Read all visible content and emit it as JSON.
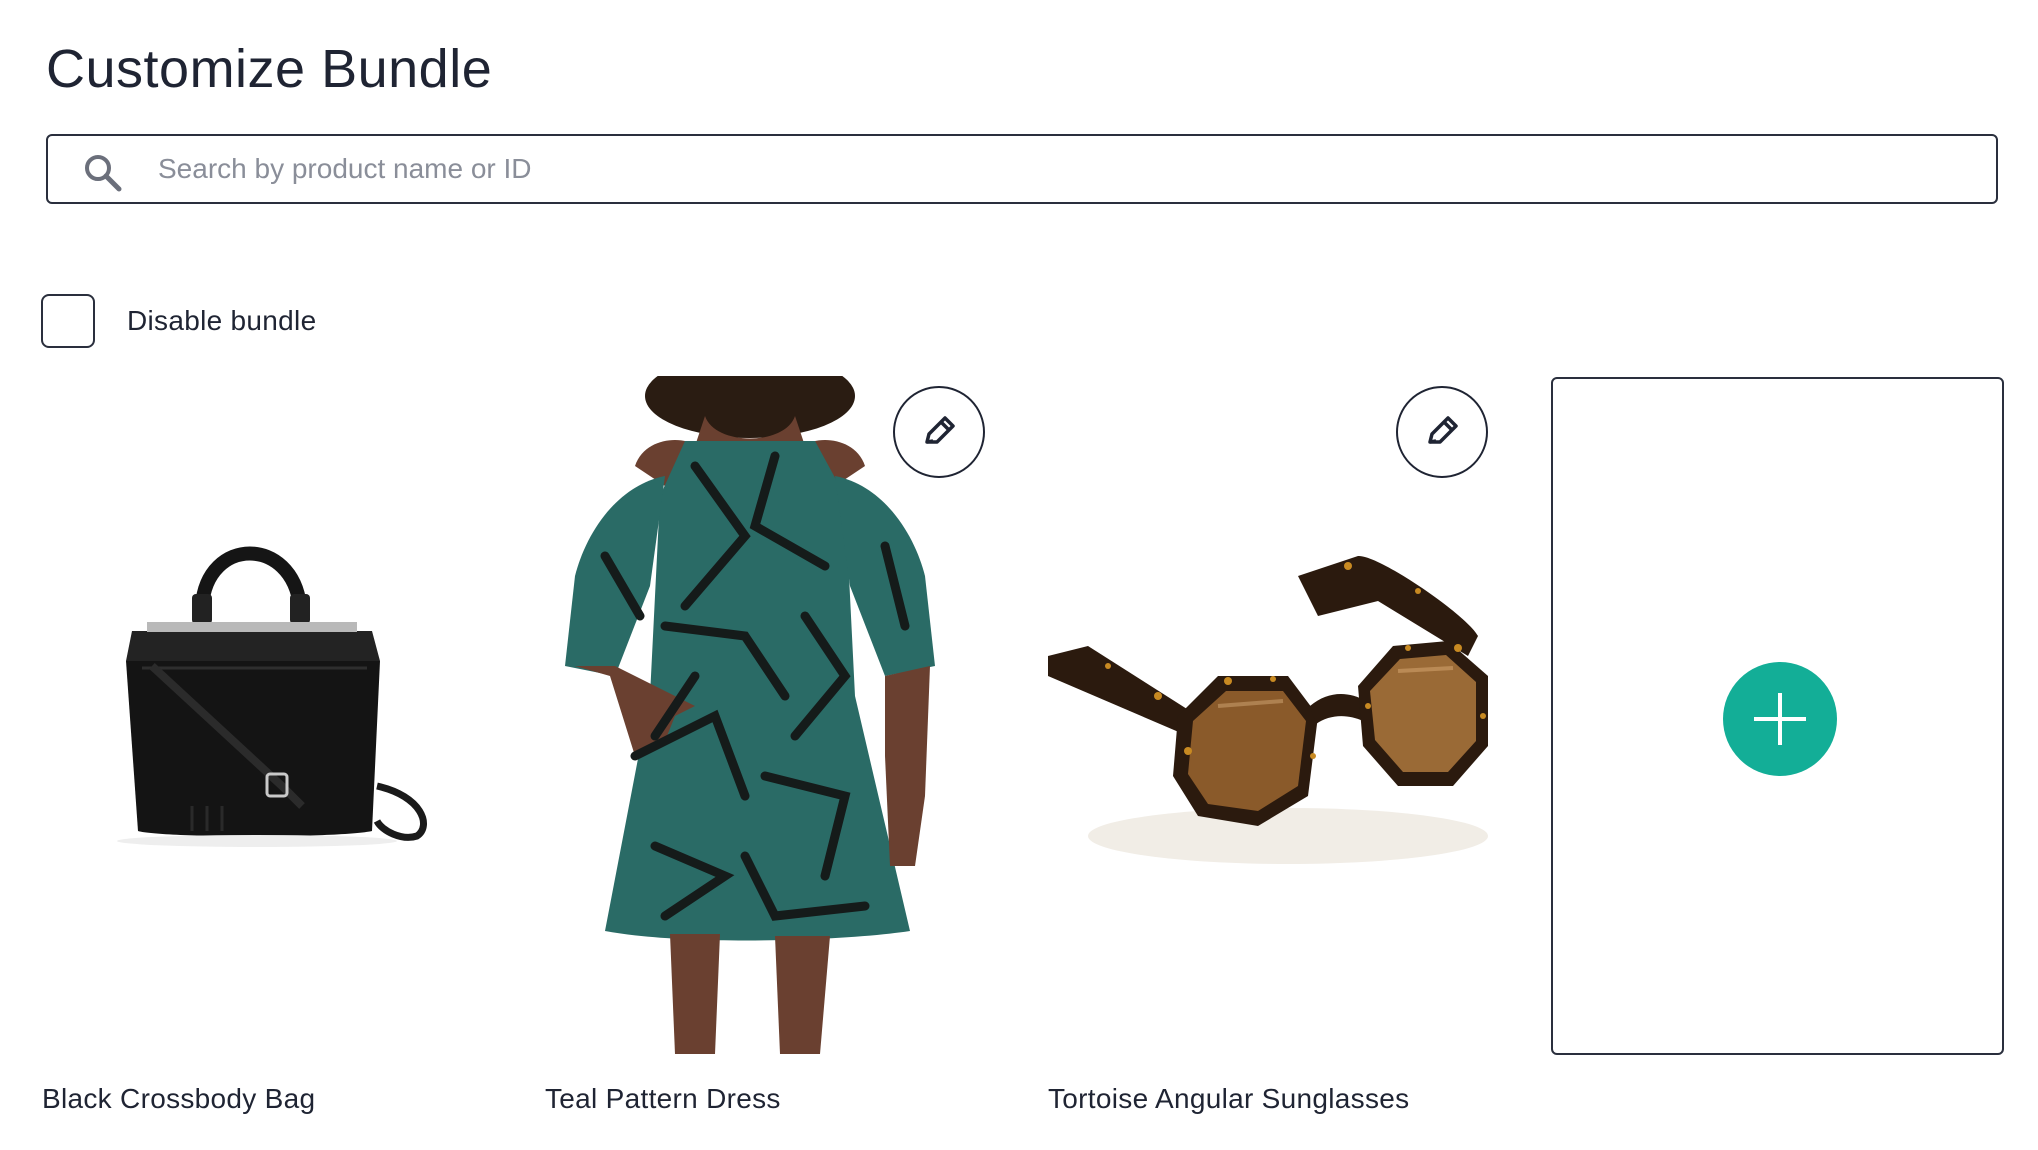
{
  "page": {
    "title": "Customize Bundle"
  },
  "search": {
    "placeholder": "Search by product name or ID",
    "value": ""
  },
  "disable_bundle": {
    "label": "Disable bundle",
    "checked": false
  },
  "products": [
    {
      "name": "Black Crossbody Bag",
      "image": "black-crossbody-bag-image",
      "editable": false
    },
    {
      "name": "Teal Pattern Dress",
      "image": "teal-pattern-dress-image",
      "editable": true
    },
    {
      "name": "Tortoise Angular Sunglasses",
      "image": "tortoise-sunglasses-image",
      "editable": true
    }
  ],
  "icons": {
    "search": "search-icon",
    "edit": "pencil-icon",
    "add": "plus-icon"
  },
  "colors": {
    "text": "#1f2433",
    "border": "#2a2f3d",
    "accent": "#13ae97",
    "placeholder": "#8a8e99"
  }
}
